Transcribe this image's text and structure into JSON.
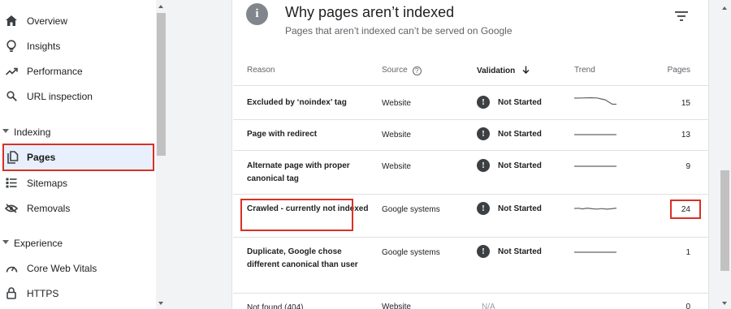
{
  "sidebar": {
    "items": [
      {
        "label": "Overview",
        "icon": "home-icon"
      },
      {
        "label": "Insights",
        "icon": "lightbulb-icon"
      },
      {
        "label": "Performance",
        "icon": "trending-up-icon"
      },
      {
        "label": "URL inspection",
        "icon": "search-icon"
      }
    ],
    "section_indexing": "Indexing",
    "indexing_items": [
      {
        "label": "Pages",
        "icon": "pages-icon",
        "active": true
      },
      {
        "label": "Sitemaps",
        "icon": "sitemap-icon"
      },
      {
        "label": "Removals",
        "icon": "removals-icon"
      }
    ],
    "section_experience": "Experience",
    "experience_items": [
      {
        "label": "Core Web Vitals",
        "icon": "gauge-icon"
      },
      {
        "label": "HTTPS",
        "icon": "lock-icon"
      }
    ]
  },
  "card": {
    "title": "Why pages aren’t indexed",
    "subtitle": "Pages that aren’t indexed can’t be served on Google",
    "icon": "info-icon"
  },
  "table": {
    "headers": {
      "reason": "Reason",
      "source": "Source",
      "validation": "Validation",
      "trend": "Trend",
      "pages": "Pages"
    },
    "rows": [
      {
        "reason": "Excluded by ‘noindex’ tag",
        "source": "Website",
        "validation": "Not Started",
        "pages": "15"
      },
      {
        "reason": "Page with redirect",
        "source": "Website",
        "validation": "Not Started",
        "pages": "13"
      },
      {
        "reason": "Alternate page with proper canonical tag",
        "source": "Website",
        "validation": "Not Started",
        "pages": "9"
      },
      {
        "reason": "Crawled - currently not indexed",
        "source": "Google systems",
        "validation": "Not Started",
        "pages": "24"
      },
      {
        "reason": "Duplicate, Google chose different canonical than user",
        "source": "Google systems",
        "validation": "Not Started",
        "pages": "1"
      },
      {
        "reason": "Not found (404)",
        "source": "Website",
        "validation": "N/A",
        "pages": "0"
      }
    ]
  },
  "colors": {
    "highlight": "#d93025",
    "active_bg": "#e8f0fe",
    "badge": "#3c4043"
  }
}
